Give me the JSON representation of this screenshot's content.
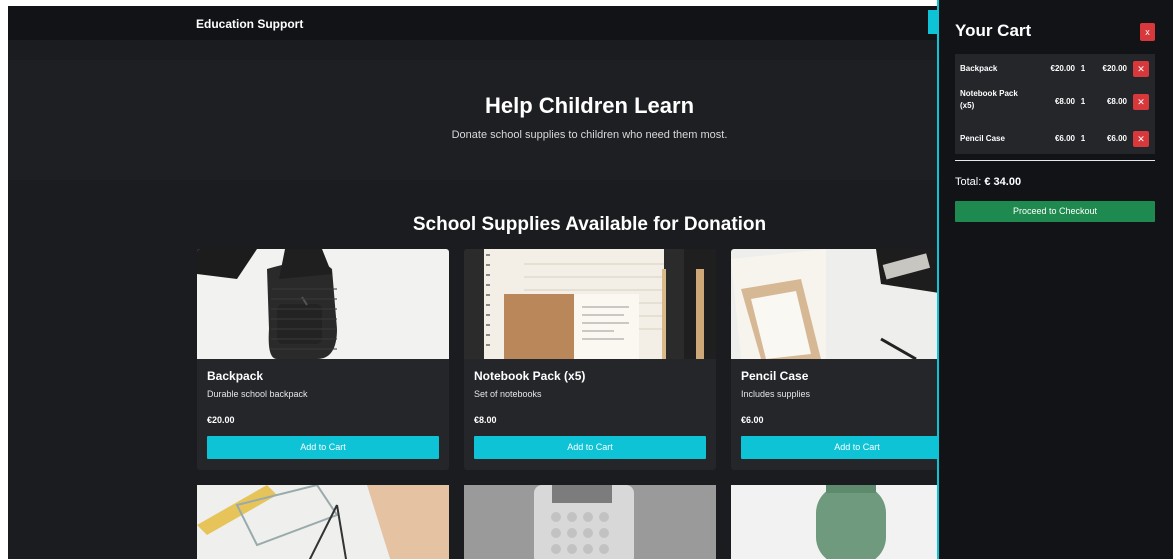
{
  "header": {
    "brand": "Education Support"
  },
  "hero": {
    "title": "Help Children Learn",
    "subtitle": "Donate school supplies to children who need them most."
  },
  "section": {
    "title": "School Supplies Available for Donation"
  },
  "products": [
    {
      "name": "Backpack",
      "description": "Durable school backpack",
      "price": "€20.00",
      "button": "Add to Cart"
    },
    {
      "name": "Notebook Pack (x5)",
      "description": "Set of notebooks",
      "price": "€8.00",
      "button": "Add to Cart"
    },
    {
      "name": "Pencil Case",
      "description": "Includes supplies",
      "price": "€6.00",
      "button": "Add to Cart"
    }
  ],
  "cart": {
    "title": "Your Cart",
    "close_label": "x",
    "items": [
      {
        "name": "Backpack",
        "price": "€20.00",
        "qty": "1",
        "total": "€20.00",
        "remove": "✕"
      },
      {
        "name": "Notebook Pack (x5)",
        "price": "€8.00",
        "qty": "1",
        "total": "€8.00",
        "remove": "✕"
      },
      {
        "name": "Pencil Case",
        "price": "€6.00",
        "qty": "1",
        "total": "€6.00",
        "remove": "✕"
      }
    ],
    "total_label": "Total:",
    "total_value": "€ 34.00",
    "checkout_label": "Proceed to Checkout"
  },
  "colors": {
    "accent": "#0fc3d6",
    "danger": "#d7383c",
    "success": "#1f8a50",
    "background": "#1b1c1f"
  }
}
